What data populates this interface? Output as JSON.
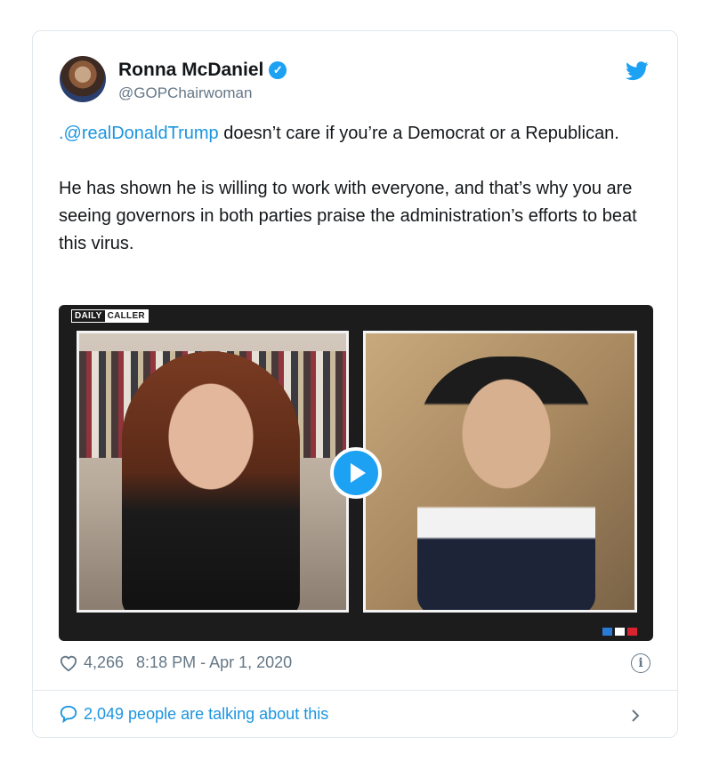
{
  "tweet": {
    "author_name": "Ronna McDaniel",
    "author_handle": "@GOPChairwoman",
    "mention": ".@realDonaldTrump",
    "text_line1_rest": " doesn’t care if you’re a Democrat or a Republican.",
    "paragraph2": "He has shown he is willing to work with everyone, and that’s why you are seeing governors in both parties praise the administration’s efforts to beat this virus.",
    "likes": "4,266",
    "timestamp": "8:18 PM - Apr 1, 2020",
    "talking": "2,049 people are talking about this"
  },
  "video": {
    "logo_part1": "DAILY",
    "logo_part2": "CALLER"
  },
  "colors": {
    "accent": "#1da1f2",
    "link": "#1b95e0",
    "muted": "#657786",
    "flag_blue": "#2b7bd6",
    "flag_white": "#ffffff",
    "flag_red": "#d9242f"
  },
  "icons": [
    "verified-badge-icon",
    "twitter-bird-icon",
    "play-icon",
    "heart-icon",
    "info-icon",
    "speech-bubble-icon",
    "chevron-right-icon"
  ]
}
